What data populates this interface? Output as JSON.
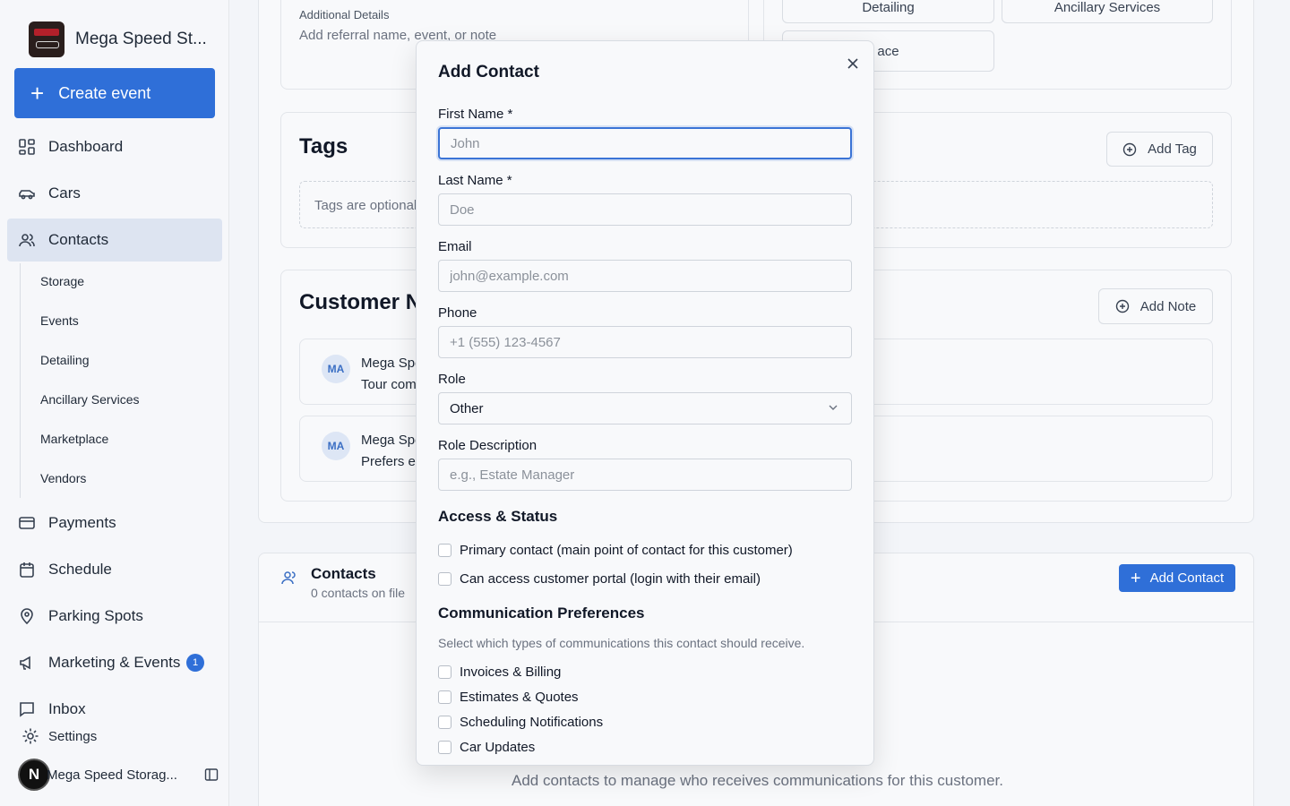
{
  "brand": {
    "name": "Mega Speed St..."
  },
  "sidebar": {
    "create_label": "Create event",
    "items": [
      {
        "label": "Dashboard"
      },
      {
        "label": "Cars"
      },
      {
        "label": "Contacts"
      },
      {
        "label": "Payments"
      },
      {
        "label": "Schedule"
      },
      {
        "label": "Parking Spots"
      },
      {
        "label": "Marketing & Events",
        "badge": "1"
      },
      {
        "label": "Inbox"
      }
    ],
    "sub_items": [
      "Storage",
      "Events",
      "Detailing",
      "Ancillary Services",
      "Marketplace",
      "Vendors"
    ],
    "settings_label": "Settings",
    "user": {
      "initial": "N",
      "name": "Mega Speed Storag..."
    }
  },
  "background": {
    "additional_details": {
      "label": "Additional Details",
      "placeholder": "Add referral name, event, or note"
    },
    "service_buttons": [
      "Detailing",
      "Ancillary Services",
      "ace"
    ],
    "tags": {
      "title": "Tags",
      "add_label": "Add Tag",
      "empty": "Tags are optional"
    },
    "notes": {
      "title": "Customer N",
      "add_label": "Add Note",
      "entries": [
        {
          "avatar": "MA",
          "name": "Mega Spe",
          "text": "Tour com"
        },
        {
          "avatar": "MA",
          "name": "Mega Spe",
          "text": "Prefers e"
        }
      ]
    },
    "contacts": {
      "title": "Contacts",
      "subtitle": "0 contacts on file",
      "add_label": "Add Contact",
      "empty": "Add contacts to manage who receives communications for this customer."
    }
  },
  "modal": {
    "title": "Add Contact",
    "fields": {
      "first_name": {
        "label": "First Name *",
        "placeholder": "John",
        "value": ""
      },
      "last_name": {
        "label": "Last Name *",
        "placeholder": "Doe",
        "value": ""
      },
      "email": {
        "label": "Email",
        "placeholder": "john@example.com",
        "value": ""
      },
      "phone": {
        "label": "Phone",
        "placeholder": "+1 (555) 123-4567",
        "value": ""
      },
      "role": {
        "label": "Role",
        "value": "Other"
      },
      "role_description": {
        "label": "Role Description",
        "placeholder": "e.g., Estate Manager",
        "value": ""
      }
    },
    "access": {
      "title": "Access & Status",
      "options": [
        "Primary contact (main point of contact for this customer)",
        "Can access customer portal (login with their email)"
      ]
    },
    "communication": {
      "title": "Communication Preferences",
      "hint": "Select which types of communications this contact should receive.",
      "options": [
        "Invoices & Billing",
        "Estimates & Quotes",
        "Scheduling Notifications",
        "Car Updates"
      ]
    }
  }
}
